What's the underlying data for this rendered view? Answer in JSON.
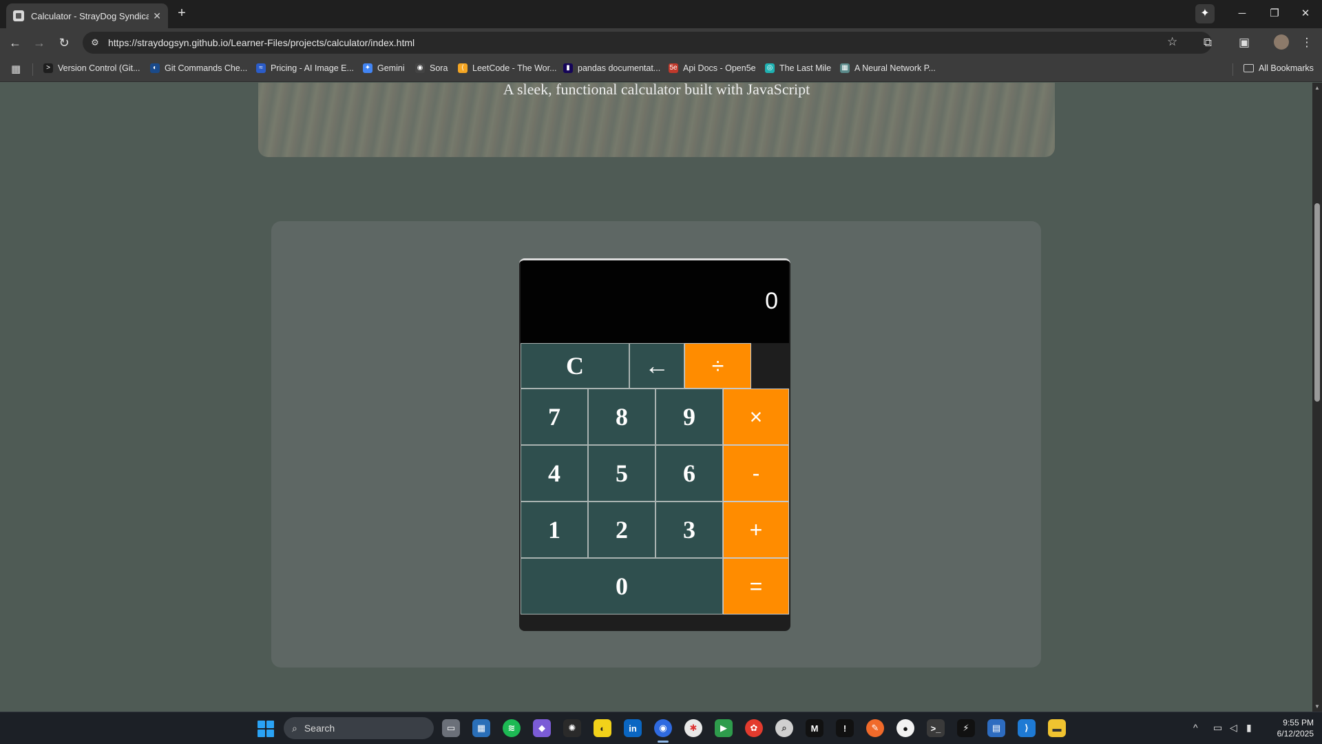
{
  "browser": {
    "tab_title": "Calculator - StrayDog Syndicati",
    "tab_close": "✕",
    "new_tab": "+",
    "url": "https://straydogsyn.github.io/Learner-Files/projects/calculator/index.html",
    "window_controls": {
      "minimize": "─",
      "maximize": "❐",
      "close": "✕"
    }
  },
  "bookmarks": [
    {
      "label": "Version Control (Git...",
      "color": "#1e1e1e",
      "icon": ">"
    },
    {
      "label": "Git Commands Che...",
      "color": "#1a4a8a",
      "icon": "◐"
    },
    {
      "label": "Pricing - AI Image E...",
      "color": "#2b5cc8",
      "icon": "≈"
    },
    {
      "label": "Gemini",
      "color": "#4285f4",
      "icon": "✦"
    },
    {
      "label": "Sora",
      "color": "#444444",
      "icon": "◉"
    },
    {
      "label": "LeetCode - The Wor...",
      "color": "#f5a623",
      "icon": "⟨"
    },
    {
      "label": "pandas documentat...",
      "color": "#150458",
      "icon": "▮"
    },
    {
      "label": "Api Docs - Open5e",
      "color": "#c0392b",
      "icon": "5e"
    },
    {
      "label": "The Last Mile",
      "color": "#1fb2b2",
      "icon": "◎"
    },
    {
      "label": "A Neural Network P...",
      "color": "#5a8a8a",
      "icon": "▦"
    }
  ],
  "all_bookmarks": "All Bookmarks",
  "page": {
    "subtitle": "A sleek, functional calculator built with JavaScript"
  },
  "calculator": {
    "display": "0",
    "keys": {
      "clear": "C",
      "backspace": "←",
      "divide": "÷",
      "multiply": "×",
      "subtract": "-",
      "add": "+",
      "equals": "=",
      "d7": "7",
      "d8": "8",
      "d9": "9",
      "d4": "4",
      "d5": "5",
      "d6": "6",
      "d1": "1",
      "d2": "2",
      "d3": "3",
      "d0": "0"
    },
    "colors": {
      "digit": "#2f4f4e",
      "operator": "#ff8c00",
      "display": "#020202"
    }
  },
  "taskbar": {
    "search_placeholder": "Search",
    "time": "9:55 PM",
    "date": "6/12/2025"
  }
}
